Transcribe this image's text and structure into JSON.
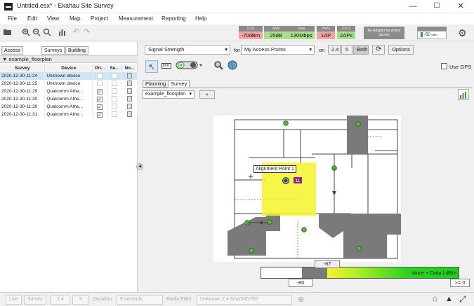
{
  "window": {
    "title": "Untitled.esx* - Ekahau Site Survey",
    "minimize": "—",
    "maximize": "☐",
    "close": "✕"
  },
  "menu": [
    "File",
    "Edit",
    "View",
    "Map",
    "Project",
    "Measurement",
    "Reporting",
    "Help"
  ],
  "toolbar": {
    "icons": [
      "open-folder-icon",
      "zoom-in-icon",
      "zoom-out-icon",
      "zoom-fit-icon",
      "chart-icon",
      "undo-icon",
      "redo-icon"
    ],
    "stats": [
      {
        "label": "S.Str",
        "value": "-70dBm",
        "color": "#f3a3a3"
      },
      {
        "label": "SNR",
        "value": "25dB",
        "color": "#a8e08a"
      },
      {
        "label": "Data",
        "value": "130Mbps",
        "color": "#a8e08a"
      },
      {
        "label": "#APs",
        "value": "1AP",
        "color": "#f3a3a3"
      },
      {
        "label": "Ch.O",
        "value": "2APs",
        "color": "#a8e08a"
      }
    ],
    "adapter_status": "No Adapter for Active Survey",
    "signal_readout": "-50",
    "signal_unit": "dBm"
  },
  "left_panel": {
    "tabs": [
      "Access Points",
      "Surveys",
      "Building"
    ],
    "active_tab": "Surveys",
    "floorplan": "example_floorplan",
    "columns": [
      "Survey",
      "Device",
      "Pri...",
      "Se...",
      "No..."
    ],
    "rows": [
      {
        "survey": "2020-12-30-11:24",
        "device": "Unknown device",
        "pri": false,
        "sel": true
      },
      {
        "survey": "2020-12-30-11:25",
        "device": "Unknown device",
        "pri": false,
        "sel": false
      },
      {
        "survey": "2020-12-30-11:29",
        "device": "Qualcomm Athe...",
        "pri": true,
        "sel": false
      },
      {
        "survey": "2020-12-30-11:30",
        "device": "Qualcomm Athe...",
        "pri": true,
        "sel": false
      },
      {
        "survey": "2020-12-30-11:30",
        "device": "Qualcomm Athe...",
        "pri": true,
        "sel": false
      },
      {
        "survey": "2020-12-30-11:31",
        "device": "Qualcomm Athe...",
        "pri": true,
        "sel": false
      }
    ]
  },
  "view_controls": {
    "visualization": "Signal Strength",
    "for_label": "for",
    "target": "My Access Points",
    "on_label": "on",
    "bands": [
      "2.4",
      "5",
      "Both"
    ],
    "active_band": "Both",
    "options_label": "Options",
    "use_gps_label": "Use GPS"
  },
  "plan_tabs": [
    "Planning",
    "Survey"
  ],
  "active_plan_tab": "Survey",
  "floorplan_select": "example_floorplan",
  "add_button": "+",
  "map": {
    "tooltip": "Alignment Point 1",
    "ap_badge": "11"
  },
  "legend": {
    "low_value": "-80",
    "mid_value": "-67",
    "high_value": ">= 0",
    "caption": "Voice + Data",
    "unit": "dBm"
  },
  "bottombar": {
    "modes": [
      "Live",
      "Survey"
    ],
    "bands": [
      "2.4",
      "5"
    ],
    "duration_label": "Duration",
    "duration_value": "5 seconds",
    "radio_filter_label": "Radio Filter",
    "radio_filter_value": "Unknown 2.4 Ghz/5457f87"
  },
  "colors": {
    "coverage_yellow": "#f4f52a",
    "wall_gray": "#7a7a7a",
    "ap_green": "#5cb83a",
    "badge_purple": "#8a2a8a"
  }
}
